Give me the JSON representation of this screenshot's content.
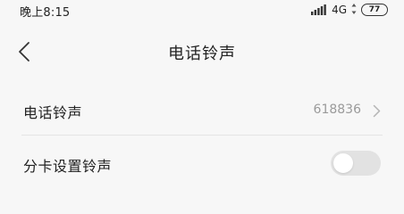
{
  "status_bar": {
    "time": "晚上8:15",
    "network": "4G",
    "battery": "77",
    "signal_icon": "signal-bars-icon"
  },
  "header": {
    "back_icon": "chevron-left-icon",
    "title": "电话铃声"
  },
  "settings": {
    "ringtone": {
      "label": "电话铃声",
      "value": "618836",
      "icon": "chevron-right-icon"
    },
    "per_sim_ringtone": {
      "label": "分卡设置铃声",
      "enabled": false
    }
  },
  "colors": {
    "background": "#f7f7f7",
    "text_primary": "#222222",
    "text_secondary": "#9a9a9a",
    "toggle_off": "#e2e2e2"
  }
}
